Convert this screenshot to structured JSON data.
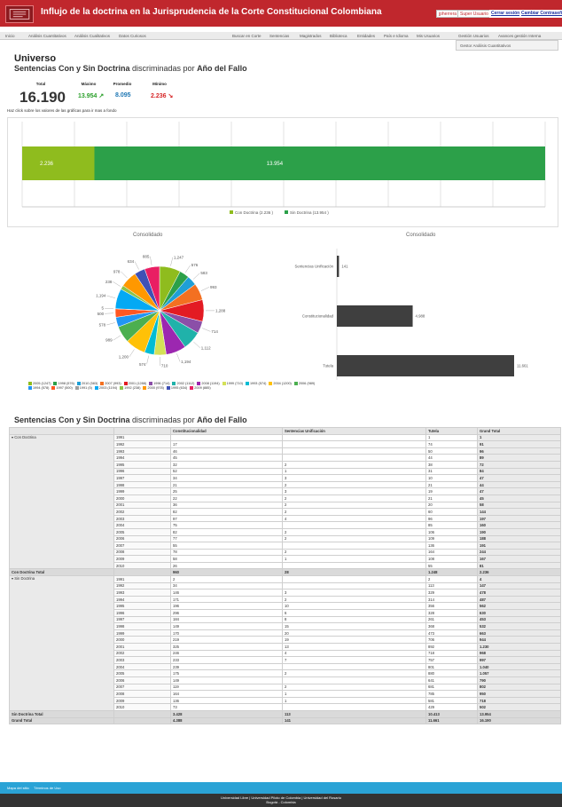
{
  "header": {
    "title": "Influjo de la doctrina en la Jurisprudencia de la Corte Constitucional Colombiana",
    "user": "jpherrera",
    "role": "Super Usuario",
    "logout": "Cerrar sesión",
    "change_password": "Cambiar Contraseña"
  },
  "nav": {
    "left": [
      "Inicio",
      "Análisis Cuantitativos",
      "Análisis Cualitativos",
      "Datos Curiosos"
    ],
    "right": [
      "Buscar en Corte",
      "Sentencias",
      "Magistrados",
      "Biblioteca",
      "Entidades",
      "País e Idioma",
      "Mis Usuarios",
      "Gestión Usuarios",
      "Avances gestión Interna"
    ],
    "dropdown_item": "Gestor Análisis Cuantitativos"
  },
  "page": {
    "heading": "Universo",
    "subtitle_a": "Sentencias Con y Sin Doctrina",
    "subtitle_b": " discriminadas por ",
    "subtitle_c": "Año del Fallo",
    "hint": "Haz click sobre los valores de las gráficas para ir mas a fondo"
  },
  "stats": {
    "total_label": "Total",
    "total": "16.190",
    "max_label": "Máximo",
    "max": "13.954",
    "avg_label": "Promedio",
    "avg": "8.095",
    "min_label": "Mínimo",
    "min": "2.236",
    "colors": {
      "max": "#2ca02c",
      "avg": "#1f77b4",
      "min": "#d62728"
    }
  },
  "stacked_bar": {
    "segments": [
      {
        "label": "2.236",
        "value": 2236,
        "color": "#8fbc1e"
      },
      {
        "label": "13.954",
        "value": 13954,
        "color": "#2ca049"
      }
    ],
    "legend": [
      {
        "text": "Con Doctrina (2.236 )",
        "color": "#8fbc1e"
      },
      {
        "text": "Sin Doctrina (13.954 )",
        "color": "#2ca049"
      }
    ]
  },
  "charts": {
    "pie_title": "Consolidado",
    "hbar_title": "Consolidado"
  },
  "chart_data": [
    {
      "type": "pie",
      "title": "Consolidado",
      "categories": [
        "2005",
        "1998",
        "2010",
        "2007",
        "2001",
        "1996",
        "2002",
        "2008",
        "1999",
        "1993",
        "2004",
        "2006",
        "1994",
        "1997",
        "1991",
        "2003",
        "1992",
        "2000",
        "1995",
        "2009"
      ],
      "values": [
        1247,
        576,
        583,
        993,
        1288,
        714,
        1112,
        1194,
        710,
        574,
        1200,
        989,
        578,
        500,
        5,
        1194,
        238,
        978,
        634,
        885
      ],
      "colors": [
        "#8fbc1e",
        "#2ca049",
        "#1f9fd6",
        "#f37021",
        "#e31b23",
        "#8b4fa8",
        "#20b2aa",
        "#9c27b0",
        "#d4e157",
        "#00bcd4",
        "#ffc107",
        "#4caf50",
        "#2196f3",
        "#ff5722",
        "#9e9e9e",
        "#03a9f4",
        "#8bc34a",
        "#ff9800",
        "#3f51b5",
        "#e91e63"
      ]
    },
    {
      "type": "bar",
      "title": "Consolidado",
      "categories": [
        "Sentencias Unificación",
        "Constitucionalidad",
        "Tutela"
      ],
      "values": [
        141,
        4988,
        11661
      ],
      "value_labels": [
        "141",
        "4.988",
        "11.661"
      ]
    },
    {
      "type": "bar",
      "stacked": true,
      "categories": [
        "Con Doctrina",
        "Sin Doctrina"
      ],
      "values": [
        2236,
        13954
      ]
    }
  ],
  "pie_legend": [
    {
      "text": "2005 (1247)",
      "color": "#8fbc1e"
    },
    {
      "text": "1998 (576)",
      "color": "#2ca049"
    },
    {
      "text": "2010 (583)",
      "color": "#1f9fd6"
    },
    {
      "text": "2007 (993)",
      "color": "#f37021"
    },
    {
      "text": "2001 (1288)",
      "color": "#e31b23"
    },
    {
      "text": "1996 (714)",
      "color": "#8b4fa8"
    },
    {
      "text": "2002 (1112)",
      "color": "#20b2aa"
    },
    {
      "text": "2008 (1194)",
      "color": "#9c27b0"
    },
    {
      "text": "1999 (710)",
      "color": "#d4e157"
    },
    {
      "text": "1993 (574)",
      "color": "#00bcd4"
    },
    {
      "text": "2004 (1200)",
      "color": "#ffc107"
    },
    {
      "text": "2006 (989)",
      "color": "#4caf50"
    },
    {
      "text": "1994 (578)",
      "color": "#2196f3"
    },
    {
      "text": "1997 (500)",
      "color": "#ff5722"
    },
    {
      "text": "1991 (5)",
      "color": "#9e9e9e"
    },
    {
      "text": "2003 (1194)",
      "color": "#03a9f4"
    },
    {
      "text": "1992 (238)",
      "color": "#8bc34a"
    },
    {
      "text": "2000 (978)",
      "color": "#ff9800"
    },
    {
      "text": "1995 (634)",
      "color": "#3f51b5"
    },
    {
      "text": "2009 (885)",
      "color": "#e91e63"
    }
  ],
  "table": {
    "title_a": "Sentencias Con y Sin Doctrina",
    "title_b": " discriminadas por ",
    "title_c": "Año del Fallo",
    "headers": [
      "",
      "",
      "Constitucionalidad",
      "Sentencias Unificación",
      "Tutela",
      "Grand Total"
    ],
    "groups": [
      {
        "name": "▾ Con Doctrina",
        "rows": [
          [
            "1991",
            "",
            "",
            "1",
            "1"
          ],
          [
            "1992",
            "17",
            "",
            "74",
            "91"
          ],
          [
            "1993",
            "46",
            "",
            "50",
            "96"
          ],
          [
            "1994",
            "45",
            "",
            "44",
            "89"
          ],
          [
            "1995",
            "32",
            "2",
            "38",
            "72"
          ],
          [
            "1996",
            "52",
            "1",
            "31",
            "84"
          ],
          [
            "1997",
            "34",
            "3",
            "10",
            "47"
          ],
          [
            "1998",
            "21",
            "2",
            "21",
            "44"
          ],
          [
            "1999",
            "25",
            "3",
            "19",
            "47"
          ],
          [
            "2000",
            "22",
            "2",
            "21",
            "45"
          ],
          [
            "2001",
            "36",
            "2",
            "20",
            "58"
          ],
          [
            "2002",
            "82",
            "2",
            "60",
            "144"
          ],
          [
            "2003",
            "97",
            "4",
            "96",
            "197"
          ],
          [
            "2004",
            "75",
            "",
            "85",
            "160"
          ],
          [
            "2005",
            "82",
            "2",
            "106",
            "190"
          ],
          [
            "2006",
            "77",
            "2",
            "109",
            "188"
          ],
          [
            "2007",
            "55",
            "",
            "136",
            "191"
          ],
          [
            "2008",
            "78",
            "2",
            "164",
            "244"
          ],
          [
            "2009",
            "58",
            "1",
            "108",
            "167"
          ],
          [
            "2010",
            "26",
            "",
            "55",
            "81"
          ]
        ],
        "total": [
          "Con Doctrina Total",
          "",
          "960",
          "28",
          "1.248",
          "2.236"
        ]
      },
      {
        "name": "▾ Sin Doctrina",
        "rows": [
          [
            "1991",
            "2",
            "",
            "2",
            "4"
          ],
          [
            "1992",
            "34",
            "",
            "113",
            "147"
          ],
          [
            "1993",
            "146",
            "3",
            "329",
            "478"
          ],
          [
            "1994",
            "171",
            "2",
            "314",
            "487"
          ],
          [
            "1995",
            "196",
            "10",
            "356",
            "562"
          ],
          [
            "1996",
            "296",
            "6",
            "328",
            "630"
          ],
          [
            "1997",
            "184",
            "8",
            "261",
            "453"
          ],
          [
            "1998",
            "149",
            "15",
            "368",
            "532"
          ],
          [
            "1999",
            "170",
            "20",
            "473",
            "663"
          ],
          [
            "2000",
            "219",
            "19",
            "706",
            "944"
          ],
          [
            "2001",
            "325",
            "13",
            "892",
            "1.230"
          ],
          [
            "2002",
            "246",
            "4",
            "718",
            "968"
          ],
          [
            "2003",
            "233",
            "7",
            "757",
            "997"
          ],
          [
            "2004",
            "239",
            "",
            "801",
            "1.040"
          ],
          [
            "2005",
            "175",
            "2",
            "880",
            "1.057"
          ],
          [
            "2006",
            "149",
            "",
            "641",
            "790"
          ],
          [
            "2007",
            "119",
            "2",
            "681",
            "802"
          ],
          [
            "2008",
            "164",
            "1",
            "785",
            "950"
          ],
          [
            "2009",
            "136",
            "1",
            "581",
            "718"
          ],
          [
            "2010",
            "73",
            "",
            "429",
            "502"
          ]
        ],
        "total": [
          "Sin Doctrina Total",
          "",
          "3.428",
          "113",
          "10.413",
          "13.954"
        ]
      }
    ],
    "grand_total": [
      "Grand Total",
      "",
      "4.388",
      "141",
      "11.661",
      "16.190"
    ]
  },
  "footer": {
    "links": [
      "Mapa del sitio",
      "Términos de Uso"
    ],
    "line1": "Universidad Libre | Universidad Piloto de Colombia | Universidad del Rosario",
    "line2": "Bogotá - Colombia"
  }
}
